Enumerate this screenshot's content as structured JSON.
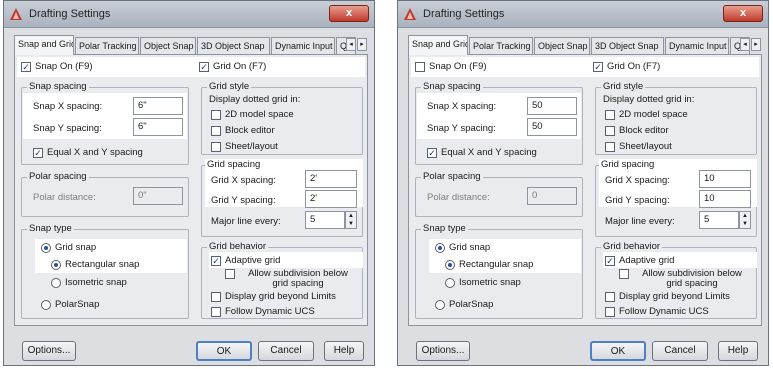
{
  "dialogs": [
    {
      "title": "Drafting Settings",
      "close": "x",
      "tabs": [
        "Snap and Grid",
        "Polar Tracking",
        "Object Snap",
        "3D Object Snap",
        "Dynamic Input",
        "Quic"
      ],
      "tab_arrows": [
        "◂",
        "▸"
      ],
      "snap_on": "Snap On (F9)",
      "snap_on_checked": true,
      "grid_on": "Grid On (F7)",
      "grid_on_checked": true,
      "snap_spacing_title": "Snap spacing",
      "snap_x_label": "Snap X spacing:",
      "snap_x_value": "6\"",
      "snap_y_label": "Snap Y spacing:",
      "snap_y_value": "6\"",
      "equal_xy": "Equal X and Y spacing",
      "equal_xy_checked": true,
      "polar_spacing_title": "Polar spacing",
      "polar_distance_label": "Polar distance:",
      "polar_distance_value": "0\"",
      "snap_type_title": "Snap type",
      "grid_snap": "Grid snap",
      "rectangular_snap": "Rectangular snap",
      "isometric_snap": "Isometric snap",
      "polar_snap": "PolarSnap",
      "grid_style_title": "Grid style",
      "display_dotted": "Display dotted grid in:",
      "model_space": "2D model space",
      "block_editor": "Block editor",
      "sheet_layout": "Sheet/layout",
      "grid_spacing_title": "Grid spacing",
      "grid_x_label": "Grid X spacing:",
      "grid_x_value": "2'",
      "grid_y_label": "Grid Y spacing:",
      "grid_y_value": "2'",
      "major_line_label": "Major line every:",
      "major_line_value": "5",
      "grid_behavior_title": "Grid behavior",
      "adaptive_grid": "Adaptive grid",
      "adaptive_grid_checked": true,
      "allow_subdivision": "Allow subdivision below grid spacing",
      "display_beyond": "Display grid beyond Limits",
      "follow_ucs": "Follow Dynamic UCS",
      "options_button": "Options...",
      "ok_button": "OK",
      "cancel_button": "Cancel",
      "help_button": "Help"
    },
    {
      "title": "Drafting Settings",
      "close": "x",
      "tabs": [
        "Snap and Grid",
        "Polar Tracking",
        "Object Snap",
        "3D Object Snap",
        "Dynamic Input",
        "Quic"
      ],
      "tab_arrows": [
        "◂",
        "▸"
      ],
      "snap_on": "Snap On (F9)",
      "snap_on_checked": false,
      "grid_on": "Grid On (F7)",
      "grid_on_checked": true,
      "snap_spacing_title": "Snap spacing",
      "snap_x_label": "Snap X spacing:",
      "snap_x_value": "50",
      "snap_y_label": "Snap Y spacing:",
      "snap_y_value": "50",
      "equal_xy": "Equal X and Y spacing",
      "equal_xy_checked": true,
      "polar_spacing_title": "Polar spacing",
      "polar_distance_label": "Polar distance:",
      "polar_distance_value": "0",
      "snap_type_title": "Snap type",
      "grid_snap": "Grid snap",
      "rectangular_snap": "Rectangular snap",
      "isometric_snap": "Isometric snap",
      "polar_snap": "PolarSnap",
      "grid_style_title": "Grid style",
      "display_dotted": "Display dotted grid in:",
      "model_space": "2D model space",
      "block_editor": "Block editor",
      "sheet_layout": "Sheet/layout",
      "grid_spacing_title": "Grid spacing",
      "grid_x_label": "Grid X spacing:",
      "grid_x_value": "10",
      "grid_y_label": "Grid Y spacing:",
      "grid_y_value": "10",
      "major_line_label": "Major line every:",
      "major_line_value": "5",
      "grid_behavior_title": "Grid behavior",
      "adaptive_grid": "Adaptive grid",
      "adaptive_grid_checked": true,
      "allow_subdivision": "Allow subdivision below grid spacing",
      "display_beyond": "Display grid beyond Limits",
      "follow_ucs": "Follow Dynamic UCS",
      "options_button": "Options...",
      "ok_button": "OK",
      "cancel_button": "Cancel",
      "help_button": "Help"
    }
  ],
  "colors": {
    "title_bar": "#aab2bf",
    "close_button": "#c0392b",
    "dialog_bg": "#dcdee2",
    "highlight": "#ffffff",
    "default_button_border": "#4f7fbf"
  },
  "icons": {
    "app": "autocad-triangle-icon",
    "checkbox_mark": "✓"
  }
}
